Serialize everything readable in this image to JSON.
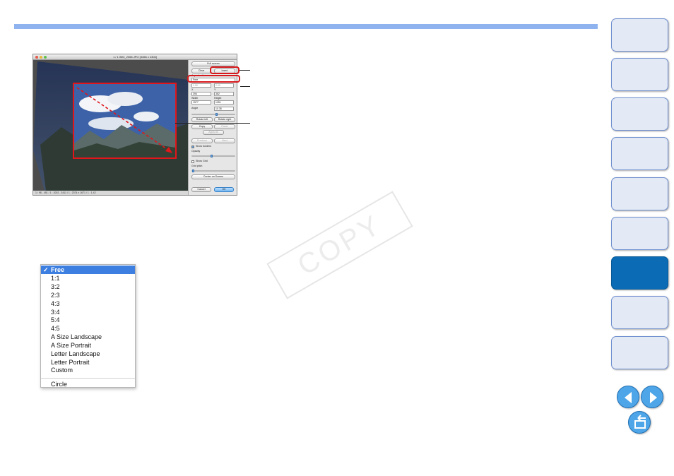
{
  "colors": {
    "accent_bar": "#8fb3ef",
    "nav_tab": "#e3e9f5",
    "nav_tab_active": "#0b6bb5",
    "highlight_red": "#d6191c",
    "menu_selected": "#3d7fe0"
  },
  "navigation": {
    "tabs": [
      {
        "icon": "section-tab",
        "active": false
      },
      {
        "icon": "section-tab",
        "active": false
      },
      {
        "icon": "section-tab",
        "active": false
      },
      {
        "icon": "section-tab",
        "active": false
      },
      {
        "icon": "section-tab",
        "active": false
      },
      {
        "icon": "section-tab",
        "active": false
      },
      {
        "icon": "section-tab",
        "active": true
      },
      {
        "icon": "section-tab",
        "active": false
      },
      {
        "icon": "section-tab",
        "active": false
      }
    ],
    "prev_icon": "arrow-left-icon",
    "next_icon": "arrow-right-icon",
    "return_icon": "return-icon"
  },
  "window": {
    "title": "1 / 1 IMG_2065.JPG [3456 x 2304]",
    "status": "1 / 98 - 451 / 1 : 1002 - 3411 / 1 : 2374 x 1671 / 1 : 1.42",
    "panel": {
      "full_screen": "Full screen",
      "clear": "Clear",
      "insert": "Insert",
      "aspect_label": "Aspect ratio",
      "aspect_value": "Free",
      "ratio_a": "1.00",
      "ratio_b": "2.00",
      "x_label": "X",
      "y_label": "Y",
      "x_value": "394",
      "y_value": "362",
      "width_label": "Width",
      "height_label": "Height",
      "width_value": "1577",
      "height_value": "1051",
      "angle_label": "Angle",
      "angle_value": "10.38",
      "rotate_left": "Rotate left",
      "rotate_right": "Rotate right",
      "copy": "Copy",
      "paste": "Paste",
      "apply_all": "Apply All",
      "previous": "Previous",
      "next": "Next",
      "show_borders": "Show borders",
      "opacity": "Opacity",
      "show_grid": "Show Grid",
      "grid_pitch": "Grid pitch",
      "center_on_screen": "Center on Screen",
      "cancel": "Cancel",
      "ok": "OK"
    }
  },
  "aspect_menu": {
    "items": [
      {
        "label": "Free",
        "selected": true
      },
      {
        "label": "1:1",
        "selected": false
      },
      {
        "label": "3:2",
        "selected": false
      },
      {
        "label": "2:3",
        "selected": false
      },
      {
        "label": "4:3",
        "selected": false
      },
      {
        "label": "3:4",
        "selected": false
      },
      {
        "label": "5:4",
        "selected": false
      },
      {
        "label": "4:5",
        "selected": false
      },
      {
        "label": "A Size Landscape",
        "selected": false
      },
      {
        "label": "A Size Portrait",
        "selected": false
      },
      {
        "label": "Letter Landscape",
        "selected": false
      },
      {
        "label": "Letter Portrait",
        "selected": false
      },
      {
        "label": "Custom",
        "selected": false
      }
    ],
    "extra_item": "Circle",
    "check_glyph": "✓"
  },
  "watermark": {
    "text": "COPY"
  }
}
